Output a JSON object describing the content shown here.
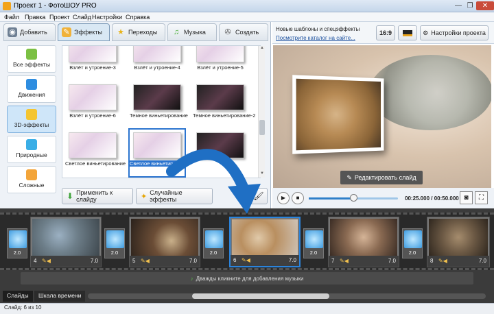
{
  "window": {
    "title": "Проект 1 - ФотоШОУ PRO",
    "controls": [
      "—",
      "❐",
      "✕"
    ]
  },
  "menu": [
    "Файл",
    "Правка",
    "Проект",
    "Слайд",
    "Настройки",
    "Справка"
  ],
  "tabs": [
    {
      "label": "Добавить",
      "icon": "camera-icon"
    },
    {
      "label": "Эффекты",
      "icon": "effects-icon"
    },
    {
      "label": "Переходы",
      "icon": "star-icon"
    },
    {
      "label": "Музыка",
      "icon": "music-icon"
    },
    {
      "label": "Создать",
      "icon": "film-reel-icon"
    }
  ],
  "categories": [
    {
      "label": "Все эффекты",
      "icon": "puzzle-icon"
    },
    {
      "label": "Движения",
      "icon": "move-icon"
    },
    {
      "label": "3D-эффекты",
      "icon": "cube-icon"
    },
    {
      "label": "Природные",
      "icon": "snowflake-icon"
    },
    {
      "label": "Сложные",
      "icon": "complex-icon"
    }
  ],
  "effects": [
    "Взлёт и утроение-3",
    "Взлёт и утроение-4",
    "Взлёт и утроение-5",
    "Взлёт и утроение-6",
    "Темное виньетирование",
    "Темное виньетирование-2",
    "Светлое виньетирование",
    "Светлое виньетирование-2",
    ""
  ],
  "buttons": {
    "apply": "Применить к слайду",
    "random": "Случайные эффекты",
    "edit_slide": "Редактировать слайд",
    "aspect": "16:9",
    "project_settings": "Настройки проекта"
  },
  "news": {
    "line1": "Новые шаблоны и спецэффекты",
    "line2": "Посмотрите каталог на сайте..."
  },
  "player": {
    "time": "00:25.000 / 00:50.000",
    "progress": 0.5
  },
  "slides": [
    {
      "num": "4",
      "dur": "7.0"
    },
    {
      "num": "5",
      "dur": "7.0"
    },
    {
      "num": "6",
      "dur": "7.0"
    },
    {
      "num": "7",
      "dur": "7.0"
    },
    {
      "num": "8",
      "dur": "7.0"
    }
  ],
  "transitions": [
    "2.0",
    "2.0",
    "2.0",
    "2.0",
    "2.0",
    "2.0"
  ],
  "music_hint": "Дважды кликните для добавления музыки",
  "bottom_tabs": [
    "Слайды",
    "Шкала времени"
  ],
  "status": "Слайд: 6 из 10"
}
